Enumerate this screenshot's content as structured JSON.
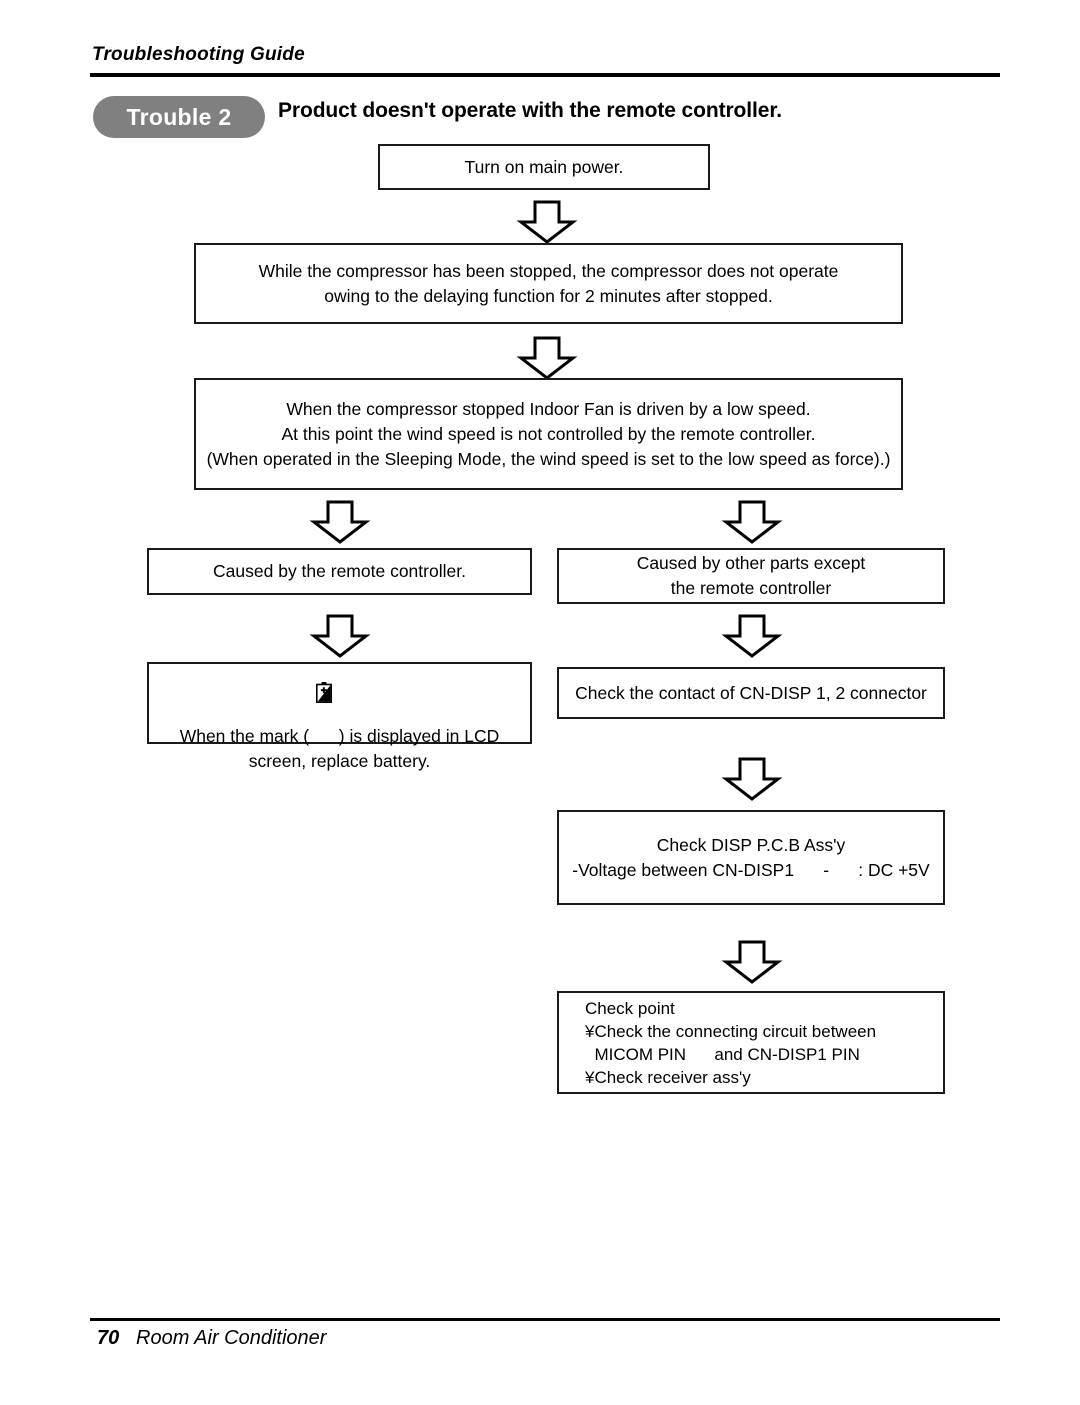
{
  "header": {
    "label": "Troubleshooting Guide"
  },
  "title_row": {
    "badge": "Trouble 2",
    "title": "Product doesn't operate with the remote controller."
  },
  "flow": {
    "box_power": {
      "lines": [
        "Turn on main power."
      ]
    },
    "box_compressor": {
      "lines": [
        "While the compressor has been stopped, the compressor does not operate",
        "owing to the delaying function for 2 minutes after stopped."
      ]
    },
    "box_fan": {
      "lines": [
        "When the compressor stopped Indoor Fan is driven by a low speed.",
        "At this point the wind speed is not controlled by the remote controller.",
        "(When operated in the Sleeping Mode, the wind speed is set to the low speed as force).)"
      ]
    },
    "box_cause_remote": {
      "lines": [
        "Caused by the remote controller."
      ]
    },
    "box_cause_other": {
      "lines": [
        "Caused by other parts except",
        "the remote controller"
      ]
    },
    "box_battery": {
      "line1_before": "When the mark ( ",
      "line1_after": " ) is displayed in LCD",
      "line2": "screen, replace battery.",
      "icon": "battery-low-icon"
    },
    "box_connector": {
      "lines": [
        "Check the contact of CN-DISP 1, 2 connector"
      ]
    },
    "box_disp_pcb": {
      "lines": [
        "Check DISP P.C.B Ass'y",
        "-Voltage between CN-DISP1      -      : DC +5V"
      ]
    },
    "box_checkpoint": {
      "lines": [
        "Check point",
        "¥Check the connecting circuit between",
        "  MICOM PIN      and CN-DISP1 PIN",
        "¥Check receiver ass'y"
      ]
    }
  },
  "arrows": {
    "name": "down-arrow-icon",
    "count": 8
  },
  "footer": {
    "page_number": "70",
    "text": "Room Air Conditioner"
  },
  "colors": {
    "badge_background": "#808080",
    "badge_text": "#ffffff",
    "rule": "#000000",
    "box_border": "#1a1a1a",
    "page_background": "#ffffff"
  }
}
